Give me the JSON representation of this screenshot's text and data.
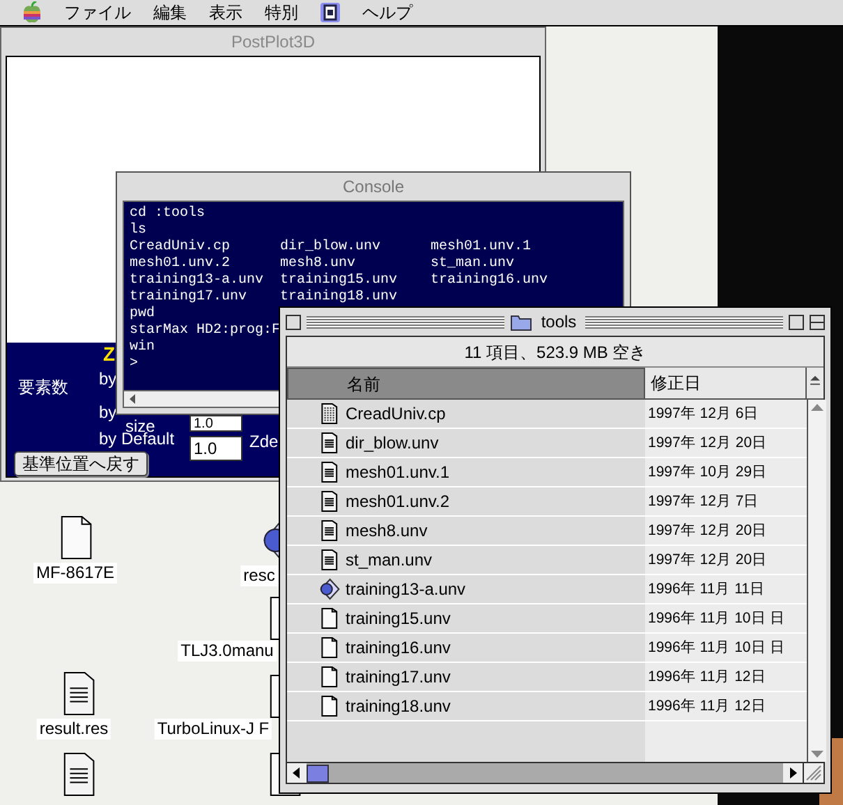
{
  "menu_bar": {
    "items": [
      {
        "kind": "apple"
      },
      {
        "kind": "text",
        "label": "ファイル"
      },
      {
        "kind": "text",
        "label": "編集"
      },
      {
        "kind": "text",
        "label": "表示"
      },
      {
        "kind": "text",
        "label": "特別"
      },
      {
        "kind": "app"
      },
      {
        "kind": "text",
        "label": "ヘルプ"
      }
    ]
  },
  "postplot_window": {
    "title": "PostPlot3D",
    "panel": {
      "heading": "Z",
      "labels": [
        "要素数",
        "by",
        "by",
        "size",
        "by Default",
        "Zde"
      ],
      "fields": [
        {
          "value": "1.0"
        },
        {
          "value": "1.0"
        }
      ],
      "button": "基準位置へ戻す"
    }
  },
  "console_window": {
    "title": "Console",
    "lines": [
      [
        "cd :tools"
      ],
      [
        "ls"
      ],
      [
        "CreadUniv.cp",
        "dir_blow.unv",
        "mesh01.unv.1"
      ],
      [
        "mesh01.unv.2",
        "mesh8.unv",
        "st_man.unv"
      ],
      [
        "training13-a.unv",
        "training15.unv",
        "training16.unv"
      ],
      [
        "training17.unv",
        "training18.unv"
      ],
      [
        "pwd"
      ],
      [
        "starMax HD2:prog:F"
      ],
      [
        "win"
      ],
      [
        ">"
      ]
    ]
  },
  "desktop_icons": [
    {
      "kind": "blank",
      "label": "MF-8617E"
    },
    {
      "kind": "app",
      "label": "resc"
    },
    {
      "kind": "blank",
      "label": "TLJ3.0manu"
    },
    {
      "kind": "text",
      "label": "result.res"
    },
    {
      "kind": "blank",
      "label": "TurboLinux-J F"
    },
    {
      "kind": "text"
    },
    {
      "kind": "blank"
    }
  ],
  "finder_window": {
    "title": "tools",
    "info": "11 項目、523.9 MB 空き",
    "columns": [
      {
        "label": "名前",
        "selected": true
      },
      {
        "label": "修正日",
        "selected": false
      }
    ],
    "rows": [
      {
        "kind": "source",
        "name": "CreadUniv.cp",
        "date": "1997年 12月 6日"
      },
      {
        "kind": "text",
        "name": "dir_blow.unv",
        "date": "1997年 12月 20日"
      },
      {
        "kind": "text",
        "name": "mesh01.unv.1",
        "date": "1997年 10月 29日"
      },
      {
        "kind": "text",
        "name": "mesh01.unv.2",
        "date": "1997年 12月 7日"
      },
      {
        "kind": "text",
        "name": "mesh8.unv",
        "date": "1997年 12月 20日"
      },
      {
        "kind": "text",
        "name": "st_man.unv",
        "date": "1997年 12月 20日"
      },
      {
        "kind": "app",
        "name": "training13-a.unv",
        "date": "1996年 11月 11日"
      },
      {
        "kind": "blank",
        "name": "training15.unv",
        "date": "1996年 11月 10日 日"
      },
      {
        "kind": "blank",
        "name": "training16.unv",
        "date": "1996年 11月 10日 日"
      },
      {
        "kind": "blank",
        "name": "training17.unv",
        "date": "1996年 11月 12日"
      },
      {
        "kind": "blank",
        "name": "training18.unv",
        "date": "1996年 11月 12日"
      }
    ]
  }
}
